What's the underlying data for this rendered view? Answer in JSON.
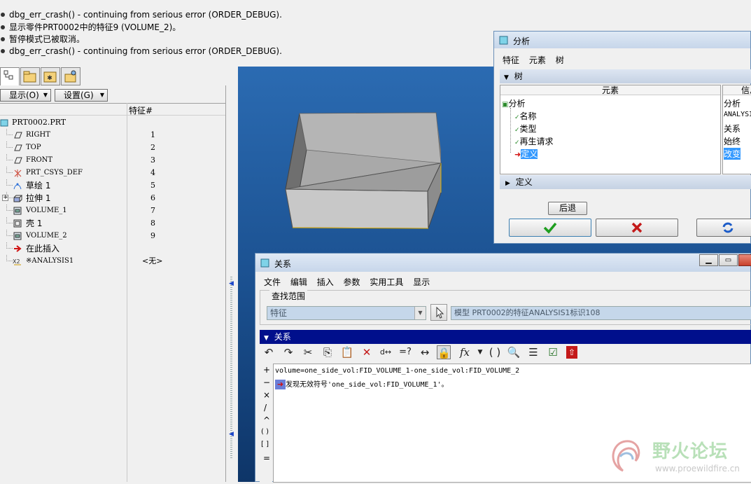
{
  "messages": [
    "dbg_err_crash() - continuing from serious error (ORDER_DEBUG).",
    "显示零件PRT0002中的特征9 (VOLUME_2)。",
    "暂停模式已被取消。",
    "dbg_err_crash() - continuing from serious error (ORDER_DEBUG)."
  ],
  "model_tree": {
    "display_btn": "显示(O)",
    "settings_btn": "设置(G)",
    "col_feature": "特征#",
    "root": "PRT0002.PRT",
    "items": [
      {
        "label": "RIGHT",
        "num": "1",
        "icon": "datum-plane-icon"
      },
      {
        "label": "TOP",
        "num": "2",
        "icon": "datum-plane-icon"
      },
      {
        "label": "FRONT",
        "num": "3",
        "icon": "datum-plane-icon"
      },
      {
        "label": "PRT_CSYS_DEF",
        "num": "4",
        "icon": "csys-icon"
      },
      {
        "label": "草绘 1",
        "num": "5",
        "icon": "sketch-icon"
      },
      {
        "label": "拉伸 1",
        "num": "6",
        "icon": "extrude-icon"
      },
      {
        "label": "VOLUME_1",
        "num": "7",
        "icon": "volume-icon"
      },
      {
        "label": "壳 1",
        "num": "8",
        "icon": "shell-icon"
      },
      {
        "label": "VOLUME_2",
        "num": "9",
        "icon": "volume-icon"
      },
      {
        "label": "在此插入",
        "num": "",
        "icon": "insert-here-icon"
      },
      {
        "label": "※ANALYSIS1",
        "num": "<无>",
        "icon": "analysis-icon"
      }
    ]
  },
  "analysis_dialog": {
    "title": "分析",
    "menu": [
      "特征",
      "元素",
      "树"
    ],
    "tree_section": "树",
    "col_element": "元素",
    "col_info": "信息",
    "tree_root": "分析",
    "tree_items": [
      "名称",
      "类型",
      "再生请求",
      "定义"
    ],
    "info_items": [
      "分析",
      "ANALYSI",
      "关系",
      "始终",
      "改变"
    ],
    "define_section": "定义",
    "back_btn": "后退"
  },
  "relations_dialog": {
    "title": "关系",
    "menu": [
      "文件",
      "编辑",
      "插入",
      "参数",
      "实用工具",
      "显示"
    ],
    "lookin_label": "查找范围",
    "lookin_value": "特征",
    "model_path": "模型 PRT0002的特征ANALYSIS1标识108",
    "section_title": "关系",
    "operators": [
      "+",
      "−",
      "×",
      "/",
      "^",
      "( )",
      "[ ]",
      "="
    ],
    "lines": [
      "volume=one_side_vol:FID_VOLUME_1-one_side_vol:FID_VOLUME_2",
      "发现无效符号'one_side_vol:FID_VOLUME_1'。"
    ]
  },
  "watermark": {
    "brand": "野火论坛",
    "url": "www.proewildfire.cn"
  },
  "colors": {
    "viewport_top": "#2b6bb2",
    "viewport_bottom": "#0e3568",
    "selection": "#3399ff",
    "section_dark": "#000f8c",
    "ok_green": "#1f9e1f",
    "cancel_red": "#c41a1a"
  }
}
